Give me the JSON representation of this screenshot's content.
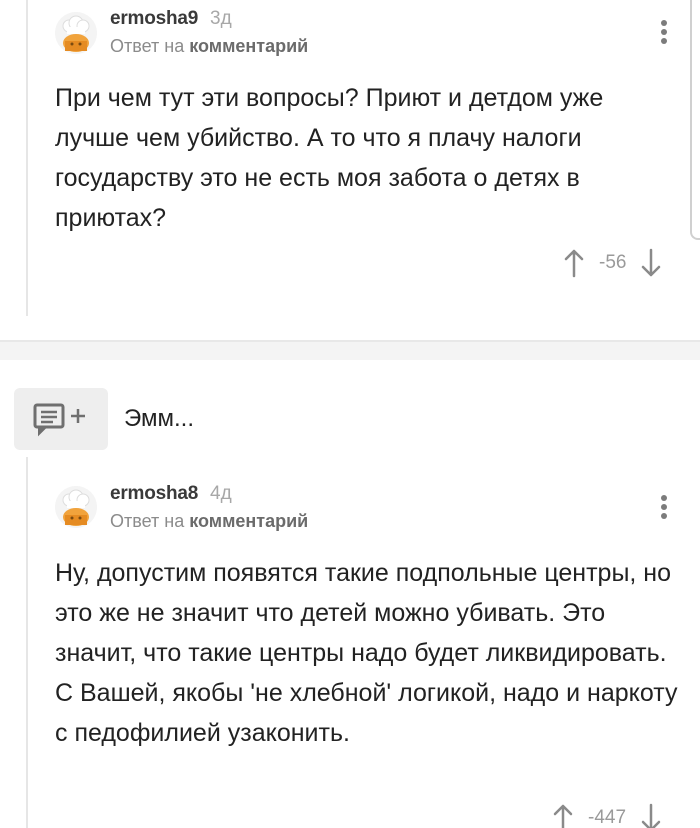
{
  "comments": [
    {
      "username": "ermosha9",
      "time": "3д",
      "reply_prefix": "Ответ на",
      "reply_target": "комментарий",
      "text": "При чем тут эти вопросы? Приют и детдом уже лучше чем убийство. А то что я плачу налоги государству это не есть моя забота о детях в приютах?",
      "score": "-56"
    },
    {
      "username": "ermosha8",
      "time": "4д",
      "reply_prefix": "Ответ на",
      "reply_target": "комментарий",
      "text": "Ну, допустим появятся такие подпольные центры, но это же не значит что детей можно убивать. Это значит, что такие центры надо будет ликвидировать. С Вашей, якобы 'не хлебной' логикой, надо и наркоту с педофилией узаконить.",
      "score": "-447"
    }
  ],
  "collapsed_branch": {
    "label": "Эмм..."
  },
  "icons": {
    "avatar": "chef-hat-avatar-icon",
    "more": "more-vertical-icon",
    "upvote": "arrow-up-icon",
    "downvote": "arrow-down-icon",
    "add_comment": "comment-add-icon"
  },
  "colors": {
    "text": "#222222",
    "meta": "#8b8b8b",
    "icon": "#7c7c7c"
  }
}
